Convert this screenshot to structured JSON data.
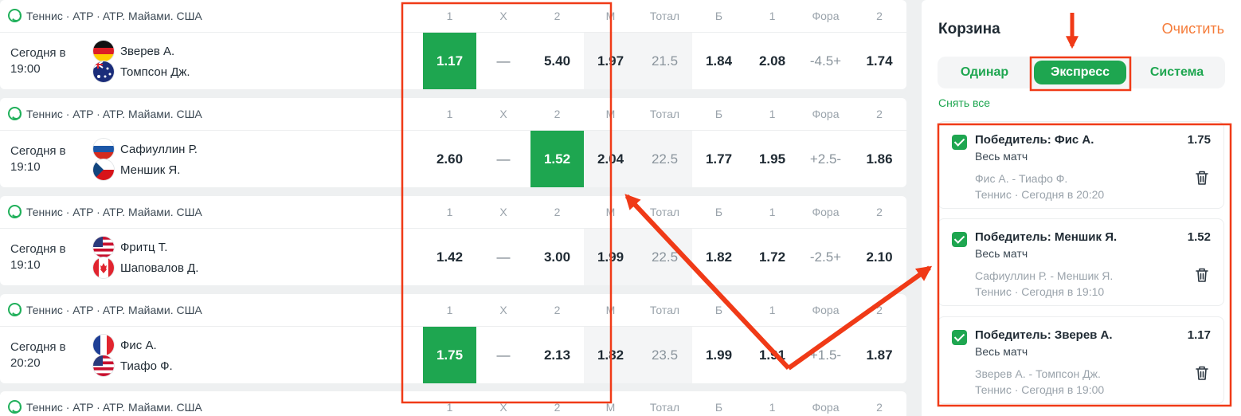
{
  "columns": [
    "1",
    "X",
    "2",
    "М",
    "Тотал",
    "Б",
    "1",
    "Фора",
    "2"
  ],
  "events": [
    {
      "league": "Теннис · ATP · ATP. Майами. США",
      "time_line1": "Сегодня в",
      "time_line2": "19:00",
      "team1": "Зверев А.",
      "team2": "Томпсон Дж.",
      "flag1": "de",
      "flag2": "au",
      "odds": [
        "1.17",
        "—",
        "5.40",
        "1.97",
        "21.5",
        "1.84",
        "2.08",
        "-4.5+",
        "1.74"
      ],
      "selected": 0
    },
    {
      "league": "Теннис · ATP · ATP. Майами. США",
      "time_line1": "Сегодня в",
      "time_line2": "19:10",
      "team1": "Сафиуллин Р.",
      "team2": "Меншик Я.",
      "flag1": "ru",
      "flag2": "cz",
      "odds": [
        "2.60",
        "—",
        "1.52",
        "2.04",
        "22.5",
        "1.77",
        "1.95",
        "+2.5-",
        "1.86"
      ],
      "selected": 2
    },
    {
      "league": "Теннис · ATP · ATP. Майами. США",
      "time_line1": "Сегодня в",
      "time_line2": "19:10",
      "team1": "Фритц Т.",
      "team2": "Шаповалов Д.",
      "flag1": "us",
      "flag2": "ca",
      "odds": [
        "1.42",
        "—",
        "3.00",
        "1.99",
        "22.5",
        "1.82",
        "1.72",
        "-2.5+",
        "2.10"
      ],
      "selected": -1
    },
    {
      "league": "Теннис · ATP · ATP. Майами. США",
      "time_line1": "Сегодня в",
      "time_line2": "20:20",
      "team1": "Фис А.",
      "team2": "Тиафо Ф.",
      "flag1": "fr",
      "flag2": "us",
      "odds": [
        "1.75",
        "—",
        "2.13",
        "1.82",
        "23.5",
        "1.99",
        "1.91",
        "+1.5-",
        "1.87"
      ],
      "selected": 0
    },
    {
      "league": "Теннис · ATP · ATP. Майами. США",
      "header_only": true
    }
  ],
  "basket": {
    "title": "Корзина",
    "clear": "Очистить",
    "tabs": [
      "Одинар",
      "Экспресс",
      "Система"
    ],
    "active_tab": 1,
    "remove_all": "Снять все",
    "bets": [
      {
        "name": "Победитель: Фис А.",
        "odd": "1.75",
        "sub": "Весь матч",
        "match": "Фис А. - Тиафо Ф.",
        "sport": "Теннис · Сегодня в 20:20"
      },
      {
        "name": "Победитель: Меншик Я.",
        "odd": "1.52",
        "sub": "Весь матч",
        "match": "Сафиуллин Р. - Меншик Я.",
        "sport": "Теннис · Сегодня в 19:10"
      },
      {
        "name": "Победитель: Зверев А.",
        "odd": "1.17",
        "sub": "Весь матч",
        "match": "Зверев А. - Томпсон Дж.",
        "sport": "Теннис · Сегодня в 19:00"
      }
    ]
  },
  "colors": {
    "green": "#1ea650",
    "orange": "#f57c3a",
    "annotation": "#f03a17"
  }
}
